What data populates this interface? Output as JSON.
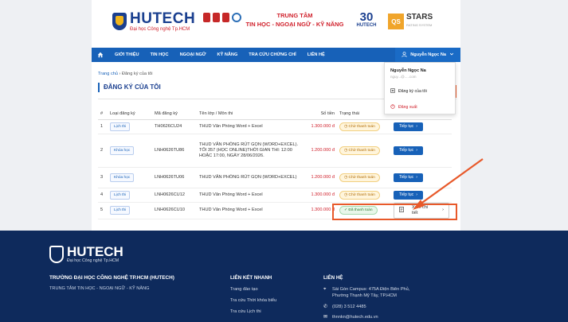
{
  "header": {
    "logo_text": "HUTECH",
    "logo_sub": "Đại học Công nghệ Tp.HCM",
    "center_title_line1": "TRUNG TÂM",
    "center_title_line2": "TIN HỌC - NGOẠI NGỮ - KỸ NĂNG",
    "anniv_number": "30",
    "anniv_text": "HUTECH",
    "qs_box": "QS",
    "qs_stars": "STARS",
    "qs_sub": "RATING SYSTEM"
  },
  "nav": {
    "items": [
      "GIỚI THIỆU",
      "TIN HỌC",
      "NGOẠI NGỮ",
      "KỸ NĂNG",
      "TRA CỨU CHỨNG CHỈ",
      "LIÊN HỆ"
    ],
    "user_name": "Nguyễn Ngọc Na"
  },
  "user_menu": {
    "name": "Nguyễn Ngọc Na",
    "email": "nguy...@.....com",
    "my_registrations": "Đăng ký của tôi",
    "logout": "Đăng xuất"
  },
  "breadcrumb": {
    "home": "Trang chủ",
    "separator": "›",
    "current": "Đăng ký của tôi"
  },
  "page_title": "ĐĂNG KÝ CỦA TÔI",
  "table": {
    "headers": [
      "#",
      "Loại đăng ký",
      "Mã đăng ký",
      "Tên lớp / Môn thi",
      "Số tiền",
      "Trạng thái",
      ""
    ],
    "rows": [
      {
        "no": "1",
        "type": "Lịch thi",
        "code": "TH0626CU24",
        "name": "THUD Văn Phòng Word + Excel",
        "fee": "1.300.000 đ",
        "status": "Chờ thanh toán",
        "action": "Tiếp tục"
      },
      {
        "no": "2",
        "type": "Khóa học",
        "code": "LNH0626TU86",
        "name": "THUD VĂN PHÒNG RÚT GỌN (WORD+EXCEL). TỐI 357 (HỌC ONLINE)THỜI GIAN THI: 12:00 HOẶC 17:00, NGÀY 28/06/2026.",
        "fee": "1.200.000 đ",
        "status": "Chờ thanh toán",
        "action": "Tiếp tục"
      },
      {
        "no": "3",
        "type": "Khóa học",
        "code": "LNH0626TU06",
        "name": "THUD VĂN PHÒNG RÚT GỌN (WORD+EXCEL)",
        "fee": "1.200.000 đ",
        "status": "Chờ thanh toán",
        "action": "Tiếp tục"
      },
      {
        "no": "4",
        "type": "Lịch thi",
        "code": "LNH0626CU12",
        "name": "THUD Văn Phòng Word + Excel",
        "fee": "1.300.000 đ",
        "status": "Chờ thanh toán",
        "action": "Tiếp tục"
      },
      {
        "no": "5",
        "type": "Lịch thi",
        "code": "LNH0626CU10",
        "name": "THUD Văn Phòng Word + Excel",
        "fee": "1.300.000 đ",
        "status": "Đã thanh toán",
        "action": "Xem chi tiết"
      }
    ]
  },
  "footer": {
    "logo_text": "HUTECH",
    "logo_sub": "Đại học Công nghệ Tp.HCM",
    "university": "TRƯỜNG ĐẠI HỌC CÔNG NGHỆ TP.HCM (HUTECH)",
    "center": "TRUNG TÂM TIN HỌC - NGOẠI NGỮ - KỸ NĂNG",
    "quick_links_title": "LIÊN KẾT NHANH",
    "quick_links": [
      "Trang đào tạo",
      "Tra cứu Thời khóa biểu",
      "Tra cứu Lịch thi"
    ],
    "contact_title": "LIÊN HỆ",
    "address_line1": "Sài Gòn Campus: 475A Điện Biên Phủ,",
    "address_line2": "Phường Thạnh Mỹ Tây, TP.HCM",
    "phone": "(028) 3 512 4485",
    "email": "thnnkn@hutech.edu.vn"
  },
  "colors": {
    "primary": "#1761b8",
    "brand_red": "#d0202b",
    "highlight": "#e8592a",
    "footer_bg": "#0e2a5c"
  }
}
